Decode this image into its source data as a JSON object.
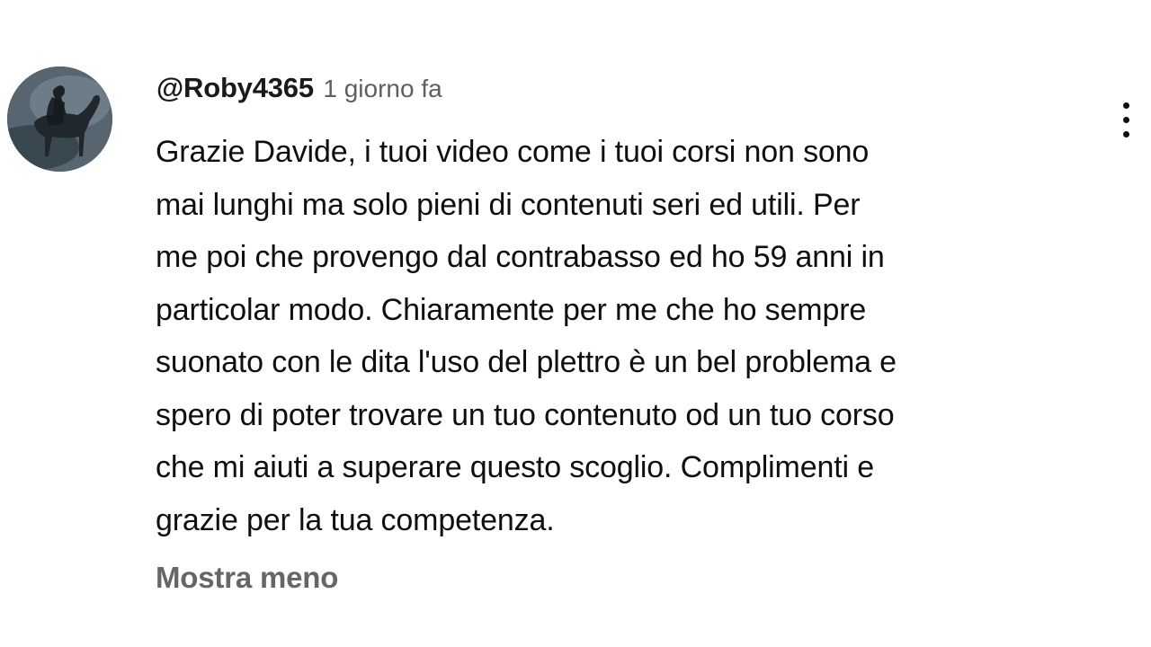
{
  "comment": {
    "avatar_icon": "user-avatar-horse-rider",
    "author": "@Roby4365",
    "time": "1 giorno fa",
    "menu_icon": "more-vertical-icon",
    "body_lines": [
      "Grazie Davide, i tuoi video come i tuoi corsi non sono",
      "mai lunghi ma solo pieni di contenuti seri ed utili. Per",
      "me poi che provengo dal contrabasso ed ho 59 anni in",
      "particolar modo. Chiaramente per me che ho sempre",
      "suonato con le dita l'uso del plettro è un bel problema e",
      "spero di poter trovare un tuo contenuto od un tuo corso",
      "che mi aiuti a superare questo scoglio. Complimenti e",
      "grazie per la tua competenza."
    ],
    "show_less_label": "Mostra meno"
  },
  "colors": {
    "text_primary": "#0f0f0f",
    "text_secondary": "#5f5f5f",
    "toggle_text": "#666666",
    "background": "#ffffff"
  }
}
